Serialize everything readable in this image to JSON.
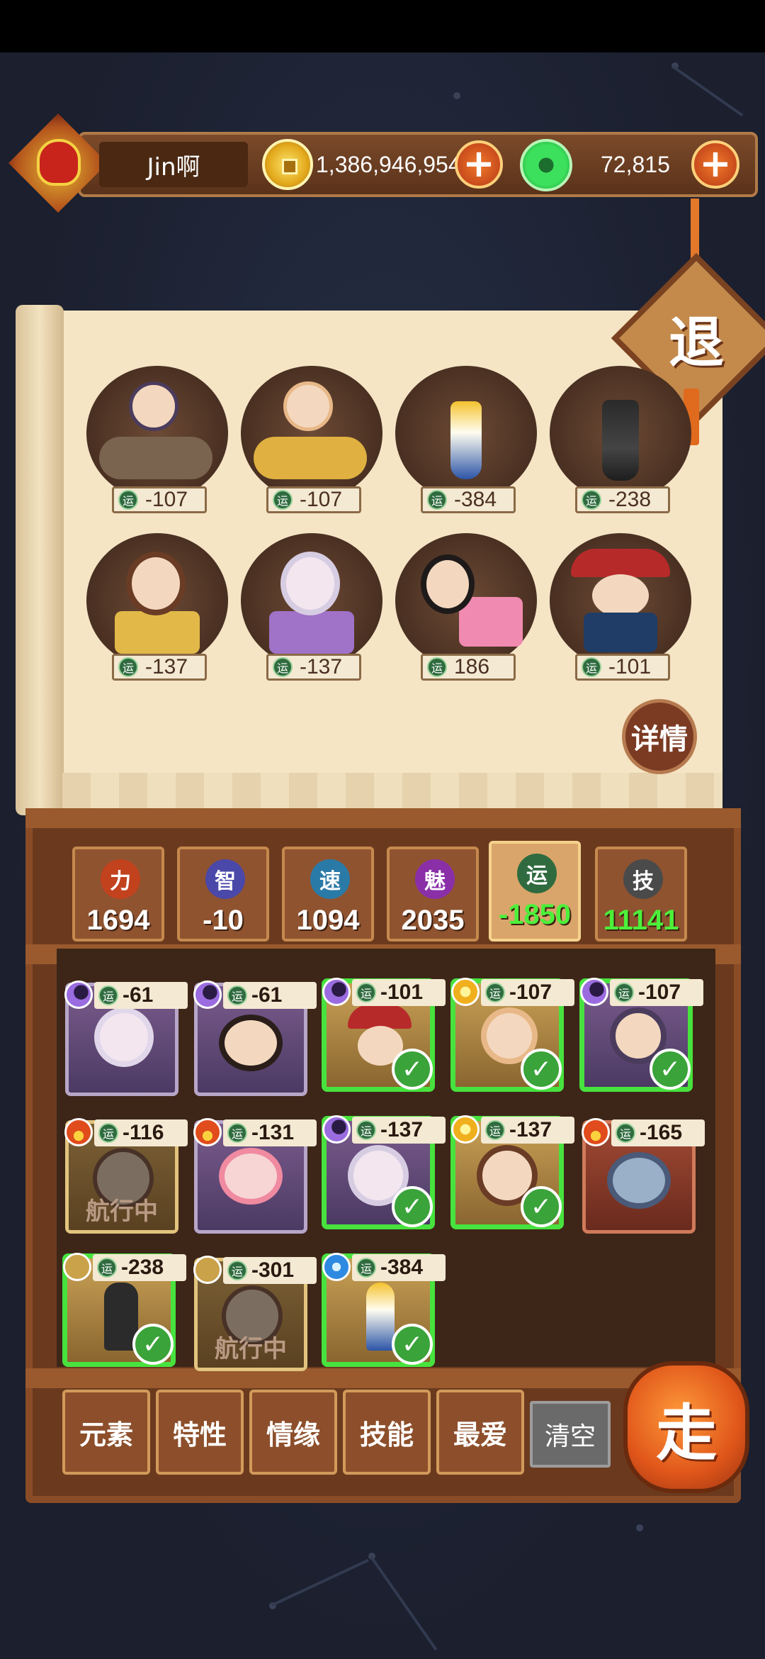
{
  "header": {
    "username": "Jin啊",
    "gold": "1,386,946,954",
    "jade": "72,815",
    "plus_symbol": "+"
  },
  "exit_label": "退",
  "detail_label": "详情",
  "lineup": [
    {
      "value": "-107"
    },
    {
      "value": "-107"
    },
    {
      "value": "-384"
    },
    {
      "value": "-238"
    },
    {
      "value": "-137"
    },
    {
      "value": "-137"
    },
    {
      "value": "186"
    },
    {
      "value": "-101"
    }
  ],
  "luck_glyph": "运",
  "stats": [
    {
      "label": "力",
      "value": "1694",
      "color": "#c2421e"
    },
    {
      "label": "智",
      "value": "-10",
      "color": "#4a48a8"
    },
    {
      "label": "速",
      "value": "1094",
      "color": "#2a7aa8"
    },
    {
      "label": "魅",
      "value": "2035",
      "color": "#8a2fa8"
    },
    {
      "label": "运",
      "value": "-1850",
      "color": "#2f6b3f"
    },
    {
      "label": "技",
      "value": "11141",
      "color": "#4a4a4a"
    }
  ],
  "heroes": [
    {
      "element": "moon",
      "value": "-61"
    },
    {
      "element": "moon",
      "value": "-61"
    },
    {
      "element": "moon",
      "value": "-101"
    },
    {
      "element": "sun",
      "value": "-107"
    },
    {
      "element": "moon",
      "value": "-107"
    },
    {
      "element": "fire",
      "value": "-116",
      "sailing": "航行中"
    },
    {
      "element": "fire",
      "value": "-131"
    },
    {
      "element": "moon",
      "value": "-137"
    },
    {
      "element": "sun",
      "value": "-137"
    },
    {
      "element": "fire",
      "value": "-165"
    },
    {
      "element": "earth",
      "value": "-238"
    },
    {
      "element": "earth",
      "value": "-301",
      "sailing": "航行中"
    },
    {
      "element": "water",
      "value": "-384"
    }
  ],
  "check_mark": "✓",
  "filters": [
    "元素",
    "特性",
    "情缘",
    "技能",
    "最爱"
  ],
  "clear_label": "清空",
  "go_label": "走"
}
